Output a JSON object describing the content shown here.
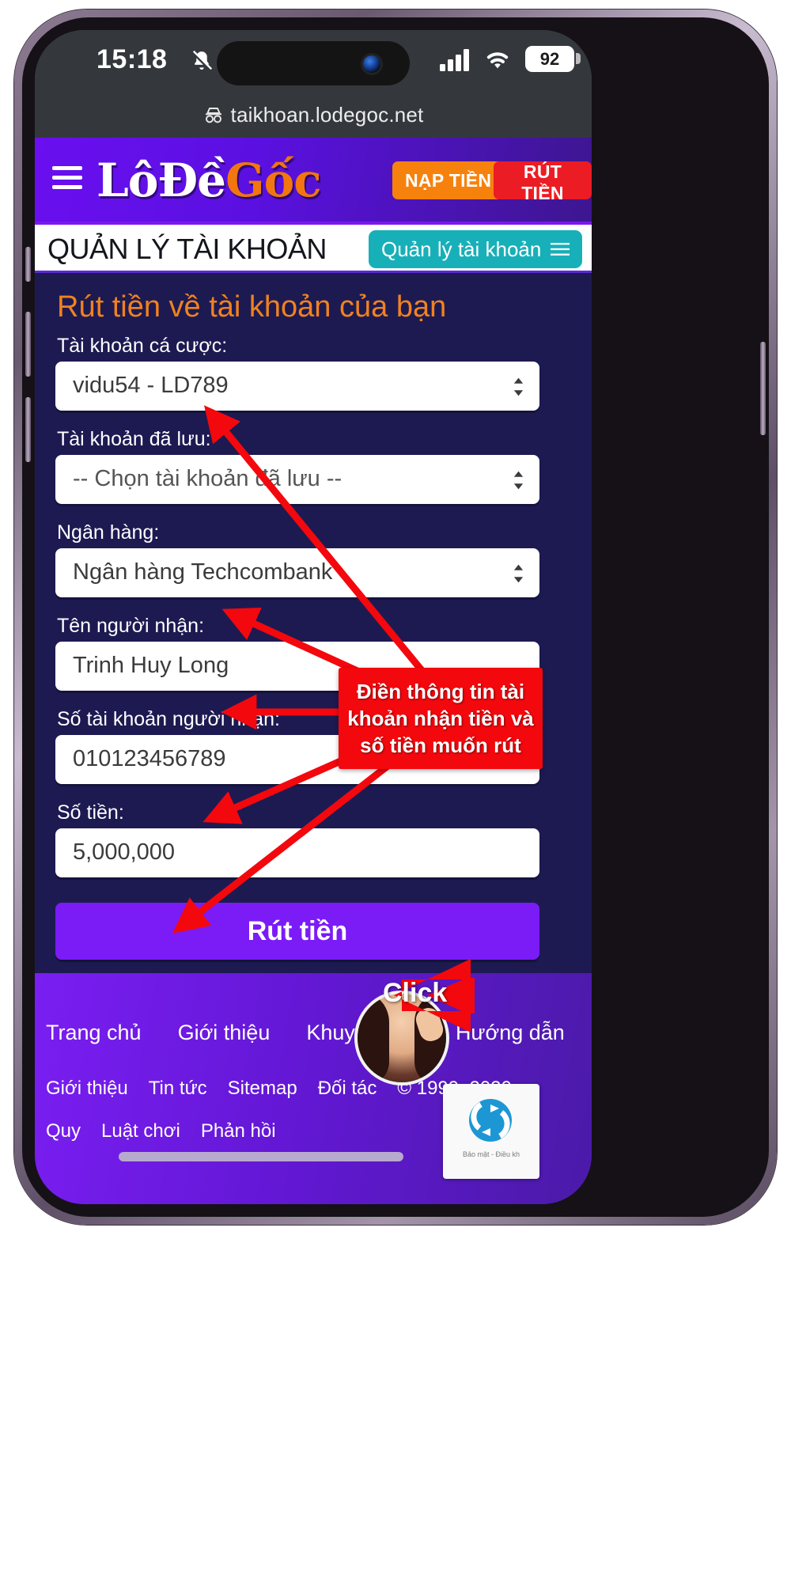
{
  "status_bar": {
    "time": "15:18",
    "bell_icon": "bell-muted-icon",
    "signal_icon": "cellular-signal-icon",
    "wifi_icon": "wifi-icon",
    "battery_percent": "92"
  },
  "browser": {
    "privacy_icon": "incognito-hat-icon",
    "url": "taikhoan.lodegoc.net"
  },
  "header": {
    "menu_icon": "hamburger-menu-icon",
    "logo_white": "LôĐề",
    "logo_orange": "Gốc",
    "deposit_label": "NẠP TIỀN",
    "withdraw_label": "RÚT TIỀN",
    "deposit_color": "#f6820d",
    "withdraw_color": "#ec1c24",
    "brand_purple": "#6a0ff0"
  },
  "page_title_bar": {
    "title": "QUẢN LÝ TÀI KHOẢN",
    "account_menu_label": "Quản lý tài khoản",
    "account_menu_icon": "hamburger-menu-icon",
    "account_menu_color": "#17b0b8"
  },
  "form": {
    "heading": "Rút tiền về tài khoản của bạn",
    "heading_color": "#f0821f",
    "fields": [
      {
        "label": "Tài khoản cá cược:",
        "value": "vidu54 - LD789",
        "type": "select"
      },
      {
        "label": "Tài khoản đã lưu:",
        "value": "-- Chọn tài khoản đã lưu --",
        "type": "select"
      },
      {
        "label": "Ngân hàng:",
        "value": "Ngân hàng Techcombank",
        "type": "select"
      },
      {
        "label": "Tên người nhận:",
        "value": "Trinh Huy Long",
        "type": "text"
      },
      {
        "label": "Số tài khoản người nhận:",
        "value": "010123456789",
        "type": "text"
      },
      {
        "label": "Số tiền:",
        "value": "5,000,000",
        "type": "text"
      }
    ],
    "submit_label": "Rút tiền",
    "submit_color": "#7b1cf7",
    "background_color": "#1d1a52"
  },
  "footer": {
    "primary_links": [
      "Trang chủ",
      "Giới thiệu",
      "Khuyến mãi",
      "Hướng dẫn"
    ],
    "secondary_links": [
      "Giới thiệu",
      "Tin tức",
      "Sitemap",
      "Đối tác"
    ],
    "copyright": "© 1999–2020",
    "tertiary_links": [
      "Quy",
      "Luật chơi",
      "Phản hồi"
    ],
    "recaptcha_text": "Bảo mật - Điều kh",
    "avatar_icon": "user-avatar"
  },
  "annotations": {
    "callout_text": "Điền thông tin tài khoản nhận tiền và số tiền muốn rút",
    "click_label": "Click",
    "arrow_color": "#f3080d"
  }
}
